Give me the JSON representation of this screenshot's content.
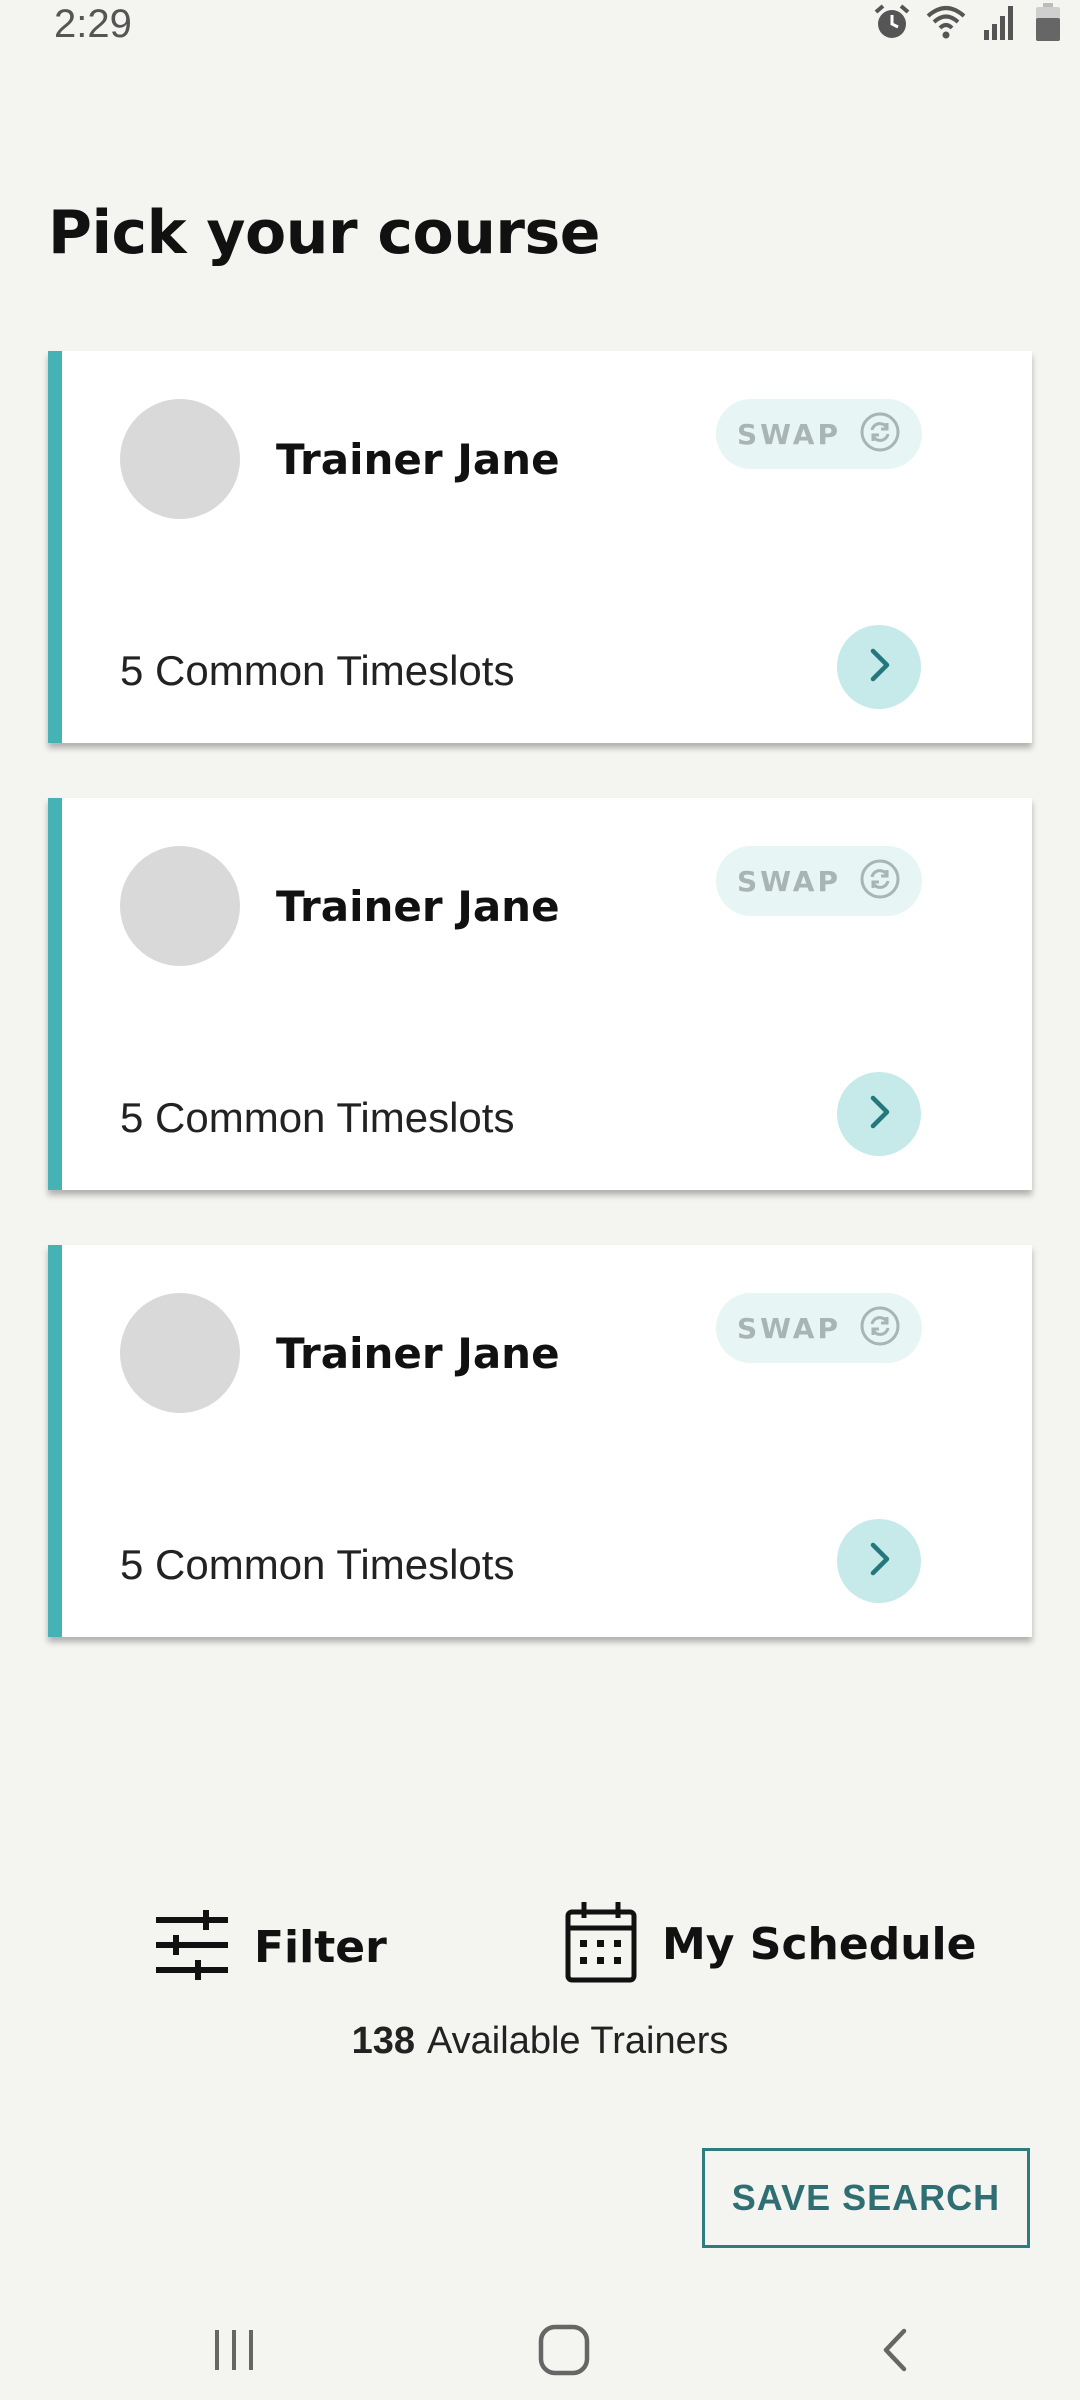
{
  "status_bar": {
    "time": "2:29",
    "icons": [
      "alarm-icon",
      "wifi-icon",
      "signal-icon",
      "battery-icon"
    ]
  },
  "page": {
    "title": "Pick your course"
  },
  "cards": [
    {
      "trainer_name": "Trainer Jane",
      "swap_label": "SWAP",
      "timeslots": "5 Common Timeslots"
    },
    {
      "trainer_name": "Trainer Jane",
      "swap_label": "SWAP",
      "timeslots": "5 Common Timeslots"
    },
    {
      "trainer_name": "Trainer Jane",
      "swap_label": "SWAP",
      "timeslots": "5 Common Timeslots"
    }
  ],
  "actions": {
    "filter_label": "Filter",
    "schedule_label": "My Schedule"
  },
  "trainers": {
    "count": "138",
    "label": "Available Trainers"
  },
  "save_search_label": "SAVE SEARCH",
  "colors": {
    "accent": "#45b3b6",
    "swap_bg": "#e7f5f5",
    "go_bg": "#c6e9ea",
    "save_border": "#2f7b80"
  }
}
